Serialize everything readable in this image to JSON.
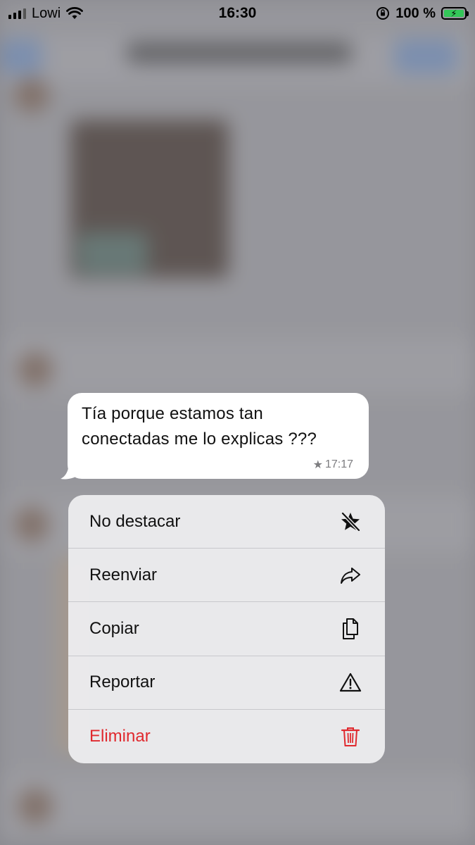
{
  "status_bar": {
    "carrier": "Lowi",
    "time": "16:30",
    "battery_percent": "100 %",
    "battery_level": 1.0,
    "signal_bars_filled": 3,
    "signal_bars_total": 4
  },
  "message": {
    "text_line1": "Tía porque estamos tan",
    "text_line2": "conectadas me lo explicas ???",
    "star": "★",
    "time": "17:17"
  },
  "menu": {
    "items": [
      {
        "label": "No destacar",
        "icon": "unstar-icon"
      },
      {
        "label": "Reenviar",
        "icon": "forward-icon"
      },
      {
        "label": "Copiar",
        "icon": "copy-icon"
      },
      {
        "label": "Reportar",
        "icon": "warning-icon"
      },
      {
        "label": "Eliminar",
        "icon": "trash-icon"
      }
    ]
  },
  "colors": {
    "danger": "#e0292e",
    "battery_fill": "#34c759",
    "bubble_bg": "#ffffff",
    "menu_bg": "#ececee"
  }
}
